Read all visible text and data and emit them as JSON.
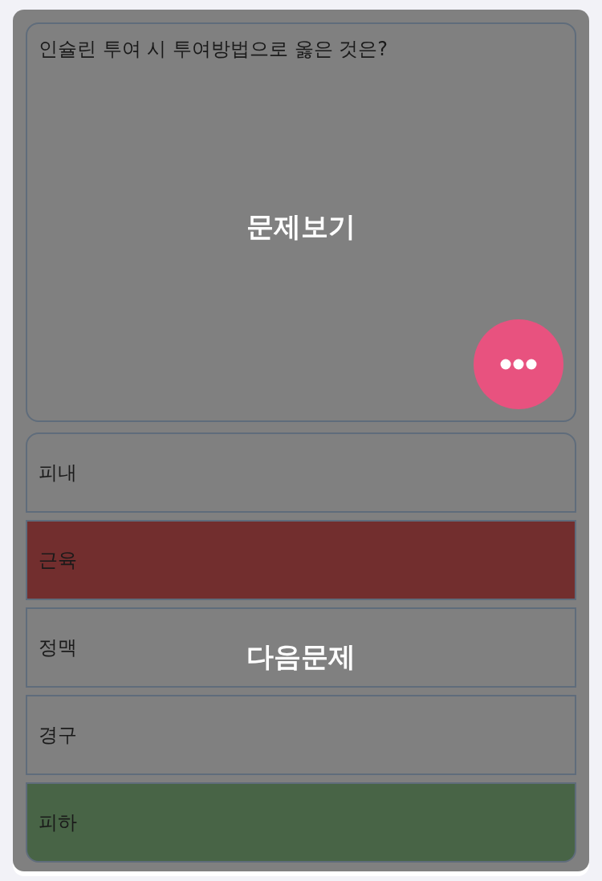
{
  "question": {
    "text": "인슐린 투여 시 투여방법으로 옳은 것은?",
    "hint_label": "문제보기"
  },
  "options": [
    {
      "label": "피내",
      "kind": "plain"
    },
    {
      "label": "근육",
      "kind": "wrong"
    },
    {
      "label": "정맥",
      "kind": "plain"
    },
    {
      "label": "경구",
      "kind": "plain"
    },
    {
      "label": "피하",
      "kind": "correct"
    }
  ],
  "next_hint_label": "다음문제"
}
